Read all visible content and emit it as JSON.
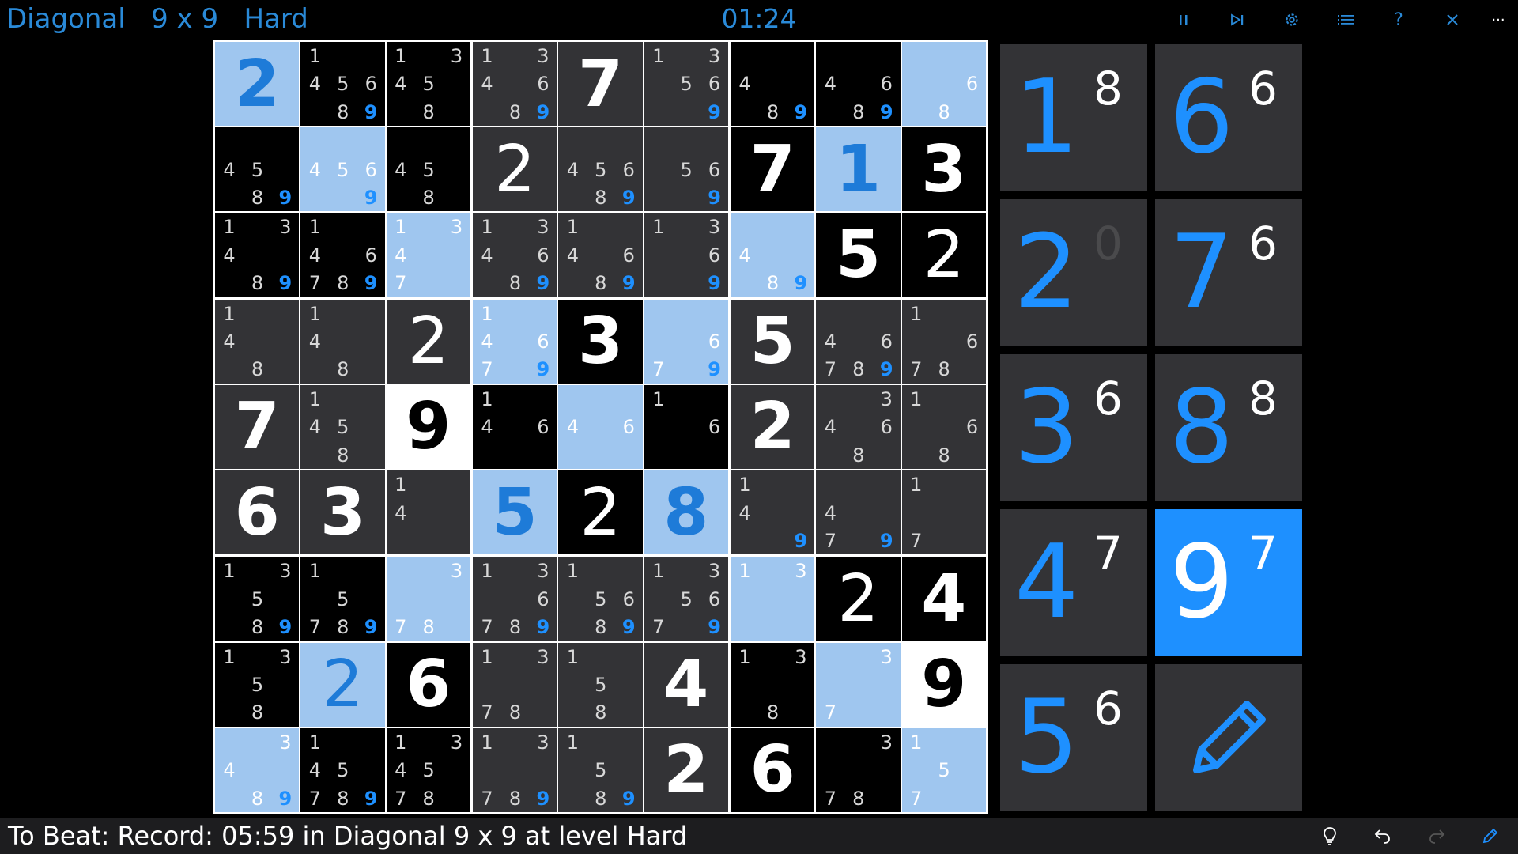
{
  "header": {
    "title": "Diagonal   9 x 9   Hard",
    "timer": "01:24"
  },
  "toolbar": {
    "pause_icon": "pause-icon",
    "skip_icon": "skip-next-icon",
    "settings_icon": "gear-icon",
    "list_icon": "list-icon",
    "help_label": "?",
    "close_icon": "close-icon",
    "more_label": "···"
  },
  "colors": {
    "accent": "#1e90ff",
    "cell_dark": "#333336",
    "cell_black": "#000000",
    "cell_highlight": "#9fc6ef",
    "cell_white": "#ffffff",
    "candidate_text": "#d8d8d8",
    "blue_digit": "#1e7bd8"
  },
  "board": {
    "cells": [
      [
        {
          "bg": "light",
          "value": "2",
          "color": "blue",
          "bold": true,
          "cands": []
        },
        {
          "bg": "black",
          "cands": [
            "1",
            "4",
            "5",
            "6",
            "8",
            "9*"
          ]
        },
        {
          "bg": "black",
          "cands": [
            "1",
            "3",
            "4",
            "5",
            "8"
          ]
        },
        {
          "bg": "dark",
          "cands": [
            "1",
            "3",
            "4",
            "6",
            "8",
            "9*"
          ]
        },
        {
          "bg": "dark",
          "value": "7",
          "color": "white",
          "bold": true,
          "cands": []
        },
        {
          "bg": "dark",
          "cands": [
            "1",
            "3",
            "5",
            "6",
            "9*"
          ]
        },
        {
          "bg": "black",
          "cands": [
            "4",
            "8",
            "9*"
          ]
        },
        {
          "bg": "black",
          "cands": [
            "4",
            "6",
            "8",
            "9*"
          ]
        },
        {
          "bg": "light",
          "cands": [
            "6",
            "8"
          ]
        }
      ],
      [
        {
          "bg": "black",
          "cands": [
            "4",
            "5",
            "8",
            "9*"
          ]
        },
        {
          "bg": "light",
          "cands": [
            "4",
            "5",
            "6",
            "9*"
          ]
        },
        {
          "bg": "black",
          "cands": [
            "4",
            "5",
            "8"
          ]
        },
        {
          "bg": "dark",
          "value": "2",
          "color": "white",
          "bold": false,
          "cands": []
        },
        {
          "bg": "dark",
          "cands": [
            "4",
            "5",
            "6",
            "8",
            "9*"
          ]
        },
        {
          "bg": "dark",
          "cands": [
            "5",
            "6",
            "9*"
          ]
        },
        {
          "bg": "black",
          "value": "7",
          "color": "white",
          "bold": true,
          "cands": []
        },
        {
          "bg": "light",
          "value": "1",
          "color": "blue",
          "bold": true,
          "cands": []
        },
        {
          "bg": "black",
          "value": "3",
          "color": "white",
          "bold": true,
          "cands": []
        }
      ],
      [
        {
          "bg": "black",
          "cands": [
            "1",
            "3",
            "4",
            "8",
            "9*"
          ]
        },
        {
          "bg": "black",
          "cands": [
            "1",
            "4",
            "6",
            "7",
            "8",
            "9*"
          ]
        },
        {
          "bg": "light",
          "cands": [
            "1",
            "3",
            "4",
            "7"
          ]
        },
        {
          "bg": "dark",
          "cands": [
            "1",
            "3",
            "4",
            "6",
            "8",
            "9*"
          ]
        },
        {
          "bg": "dark",
          "cands": [
            "1",
            "4",
            "6",
            "8",
            "9*"
          ]
        },
        {
          "bg": "dark",
          "cands": [
            "1",
            "3",
            "6",
            "9*"
          ]
        },
        {
          "bg": "light",
          "cands": [
            "4",
            "8",
            "9*"
          ]
        },
        {
          "bg": "black",
          "value": "5",
          "color": "white",
          "bold": true,
          "cands": []
        },
        {
          "bg": "black",
          "value": "2",
          "color": "white",
          "bold": false,
          "cands": []
        }
      ],
      [
        {
          "bg": "dark",
          "cands": [
            "1",
            "4",
            "8"
          ]
        },
        {
          "bg": "dark",
          "cands": [
            "1",
            "4",
            "8"
          ]
        },
        {
          "bg": "dark",
          "value": "2",
          "color": "white",
          "bold": false,
          "cands": []
        },
        {
          "bg": "light",
          "cands": [
            "1",
            "4",
            "6",
            "7",
            "9*"
          ]
        },
        {
          "bg": "black",
          "value": "3",
          "color": "white",
          "bold": true,
          "cands": []
        },
        {
          "bg": "light",
          "cands": [
            "6",
            "7",
            "9*"
          ]
        },
        {
          "bg": "dark",
          "value": "5",
          "color": "white",
          "bold": true,
          "cands": []
        },
        {
          "bg": "dark",
          "cands": [
            "4",
            "6",
            "7",
            "8",
            "9*"
          ]
        },
        {
          "bg": "dark",
          "cands": [
            "1",
            "6",
            "7",
            "8"
          ]
        }
      ],
      [
        {
          "bg": "dark",
          "value": "7",
          "color": "white",
          "bold": true,
          "cands": []
        },
        {
          "bg": "dark",
          "cands": [
            "1",
            "4",
            "5",
            "8"
          ]
        },
        {
          "bg": "white",
          "value": "9",
          "color": "black",
          "bold": true,
          "cands": []
        },
        {
          "bg": "black",
          "cands": [
            "1",
            "4",
            "6"
          ]
        },
        {
          "bg": "light",
          "cands": [
            "4",
            "6"
          ]
        },
        {
          "bg": "black",
          "cands": [
            "1",
            "6"
          ]
        },
        {
          "bg": "dark",
          "value": "2",
          "color": "white",
          "bold": true,
          "cands": []
        },
        {
          "bg": "dark",
          "cands": [
            "3",
            "4",
            "6",
            "8"
          ]
        },
        {
          "bg": "dark",
          "cands": [
            "1",
            "6",
            "8"
          ]
        }
      ],
      [
        {
          "bg": "dark",
          "value": "6",
          "color": "white",
          "bold": true,
          "cands": []
        },
        {
          "bg": "dark",
          "value": "3",
          "color": "white",
          "bold": true,
          "cands": []
        },
        {
          "bg": "dark",
          "cands": [
            "1",
            "4"
          ]
        },
        {
          "bg": "light",
          "value": "5",
          "color": "blue",
          "bold": true,
          "cands": []
        },
        {
          "bg": "black",
          "value": "2",
          "color": "white",
          "bold": false,
          "cands": []
        },
        {
          "bg": "light",
          "value": "8",
          "color": "blue",
          "bold": true,
          "cands": []
        },
        {
          "bg": "dark",
          "cands": [
            "1",
            "4",
            "9*"
          ]
        },
        {
          "bg": "dark",
          "cands": [
            "4",
            "7",
            "9*"
          ]
        },
        {
          "bg": "dark",
          "cands": [
            "1",
            "7"
          ]
        }
      ],
      [
        {
          "bg": "black",
          "cands": [
            "1",
            "3",
            "5",
            "8",
            "9*"
          ]
        },
        {
          "bg": "black",
          "cands": [
            "1",
            "5",
            "7",
            "8",
            "9*"
          ]
        },
        {
          "bg": "light",
          "cands": [
            "3",
            "7",
            "8"
          ]
        },
        {
          "bg": "dark",
          "cands": [
            "1",
            "3",
            "6",
            "7",
            "8",
            "9*"
          ]
        },
        {
          "bg": "dark",
          "cands": [
            "1",
            "5",
            "6",
            "8",
            "9*"
          ]
        },
        {
          "bg": "dark",
          "cands": [
            "1",
            "3",
            "5",
            "6",
            "7",
            "9*"
          ]
        },
        {
          "bg": "light",
          "cands": [
            "1",
            "3"
          ]
        },
        {
          "bg": "black",
          "value": "2",
          "color": "white",
          "bold": false,
          "cands": []
        },
        {
          "bg": "black",
          "value": "4",
          "color": "white",
          "bold": true,
          "cands": []
        }
      ],
      [
        {
          "bg": "black",
          "cands": [
            "1",
            "3",
            "5",
            "8"
          ]
        },
        {
          "bg": "light",
          "value": "2",
          "color": "blue",
          "bold": false,
          "cands": []
        },
        {
          "bg": "black",
          "value": "6",
          "color": "white",
          "bold": true,
          "cands": []
        },
        {
          "bg": "dark",
          "cands": [
            "1",
            "3",
            "7",
            "8"
          ]
        },
        {
          "bg": "dark",
          "cands": [
            "1",
            "5",
            "8"
          ]
        },
        {
          "bg": "dark",
          "value": "4",
          "color": "white",
          "bold": true,
          "cands": []
        },
        {
          "bg": "black",
          "cands": [
            "1",
            "3",
            "8"
          ]
        },
        {
          "bg": "light",
          "cands": [
            "3",
            "7"
          ]
        },
        {
          "bg": "white",
          "value": "9",
          "color": "black",
          "bold": true,
          "cands": []
        }
      ],
      [
        {
          "bg": "light",
          "cands": [
            "3",
            "4",
            "8",
            "9*"
          ]
        },
        {
          "bg": "black",
          "cands": [
            "1",
            "4",
            "5",
            "7",
            "8",
            "9*"
          ]
        },
        {
          "bg": "black",
          "cands": [
            "1",
            "3",
            "4",
            "5",
            "7",
            "8"
          ]
        },
        {
          "bg": "dark",
          "cands": [
            "1",
            "3",
            "7",
            "8",
            "9*"
          ]
        },
        {
          "bg": "dark",
          "cands": [
            "1",
            "5",
            "8",
            "9*"
          ]
        },
        {
          "bg": "dark",
          "value": "2",
          "color": "white",
          "bold": true,
          "cands": []
        },
        {
          "bg": "black",
          "value": "6",
          "color": "white",
          "bold": true,
          "cands": []
        },
        {
          "bg": "black",
          "cands": [
            "3",
            "7",
            "8"
          ]
        },
        {
          "bg": "light",
          "cands": [
            "1",
            "5",
            "7"
          ]
        }
      ]
    ]
  },
  "numpad": {
    "keys": [
      {
        "digit": "1",
        "remaining": "8",
        "active": false
      },
      {
        "digit": "6",
        "remaining": "6",
        "active": false
      },
      {
        "digit": "2",
        "remaining": "0",
        "active": false
      },
      {
        "digit": "7",
        "remaining": "6",
        "active": false
      },
      {
        "digit": "3",
        "remaining": "6",
        "active": false
      },
      {
        "digit": "8",
        "remaining": "8",
        "active": false
      },
      {
        "digit": "4",
        "remaining": "7",
        "active": false
      },
      {
        "digit": "9",
        "remaining": "7",
        "active": true
      },
      {
        "digit": "5",
        "remaining": "6",
        "active": false
      }
    ],
    "pencil_icon": "pencil-icon"
  },
  "footer": {
    "status": "To Beat: Record: 05:59 in Diagonal 9 x 9 at level Hard",
    "hint_icon": "lightbulb-icon",
    "undo_icon": "undo-icon",
    "redo_icon": "redo-icon",
    "edit_icon": "pencil-icon"
  }
}
